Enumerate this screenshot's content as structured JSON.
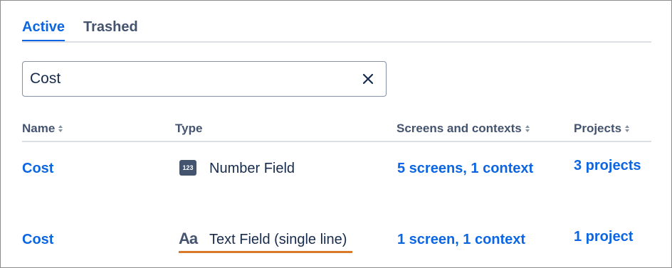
{
  "tabs": [
    {
      "label": "Active",
      "active": true
    },
    {
      "label": "Trashed",
      "active": false
    }
  ],
  "search": {
    "value": "Cost",
    "clear_icon": "close-icon"
  },
  "table": {
    "columns": [
      {
        "label": "Name",
        "sortable": true
      },
      {
        "label": "Type",
        "sortable": false
      },
      {
        "label": "Screens and contexts",
        "sortable": true
      },
      {
        "label": "Projects",
        "sortable": true
      }
    ],
    "rows": [
      {
        "name": "Cost",
        "type_icon": "number-field-icon",
        "type_icon_text": "123",
        "type": "Number Field",
        "screens": "5 screens, 1 context",
        "projects": "3 projects"
      },
      {
        "name": "Cost",
        "type_icon": "text-field-icon",
        "type_icon_text": "Aa",
        "type": "Text Field (single line)",
        "screens": "1 screen, 1 context",
        "projects": "1 project"
      }
    ]
  },
  "colors": {
    "link": "#0c66e4",
    "highlight": "#d9792b",
    "muted": "#44546f"
  }
}
